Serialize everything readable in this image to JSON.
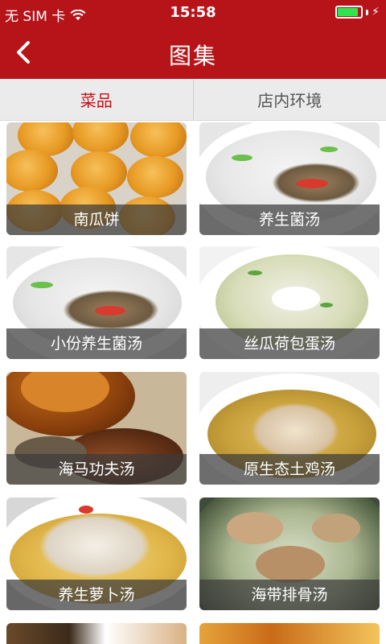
{
  "status": {
    "carrier": "无 SIM 卡",
    "time": "15:58",
    "battery_level": 0.9
  },
  "header": {
    "title": "图集",
    "back_icon": "chevron-left-icon"
  },
  "tabs": [
    {
      "label": "菜品",
      "active": true
    },
    {
      "label": "店内环境",
      "active": false
    }
  ],
  "items": [
    {
      "label": "南瓜饼"
    },
    {
      "label": "养生菌汤"
    },
    {
      "label": "小份养生菌汤"
    },
    {
      "label": "丝瓜荷包蛋汤"
    },
    {
      "label": "海马功夫汤"
    },
    {
      "label": "原生态土鸡汤"
    },
    {
      "label": "养生萝卜汤"
    },
    {
      "label": "海带排骨汤"
    }
  ],
  "colors": {
    "brand_red": "#b7141a",
    "tab_active": "#c1121a",
    "tab_bg": "#ebebeb"
  }
}
